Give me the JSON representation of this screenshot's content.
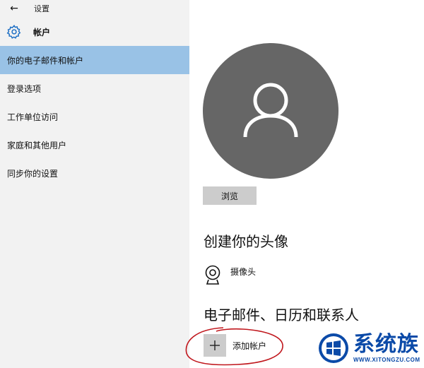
{
  "window": {
    "back_glyph": "←",
    "title": "设置"
  },
  "header": {
    "icon": "gear-icon",
    "title": "帐户"
  },
  "sidebar": {
    "items": [
      {
        "label": "你的电子邮件和帐户",
        "active": true
      },
      {
        "label": "登录选项",
        "active": false
      },
      {
        "label": "工作单位访问",
        "active": false
      },
      {
        "label": "家庭和其他用户",
        "active": false
      },
      {
        "label": "同步你的设置",
        "active": false
      }
    ]
  },
  "main": {
    "avatar_icon": "user-silhouette-icon",
    "browse_label": "浏览",
    "create_avatar_title": "创建你的头像",
    "camera": {
      "icon": "webcam-icon",
      "label": "摄像头"
    },
    "accounts_title": "电子邮件、日历和联系人",
    "add_account": {
      "icon": "plus-icon",
      "label": "添加帐户"
    }
  },
  "watermark": {
    "text": "系统族",
    "url": "WWW.XITONGZU.COM"
  },
  "colors": {
    "sidebar_bg": "#f2f2f2",
    "active_item": "#99c2e6",
    "avatar_bg": "#666666",
    "button_bg": "#cccccc",
    "annotation": "#c0161c",
    "brand_blue": "#0b4aa8"
  }
}
